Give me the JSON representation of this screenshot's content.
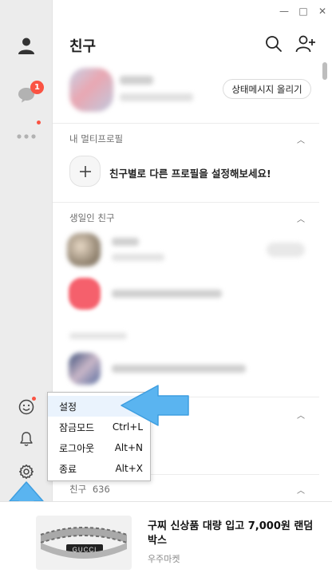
{
  "window": {
    "minimize": "—",
    "maximize": "□",
    "close": "✕"
  },
  "sidebar": {
    "chats_badge": "1"
  },
  "header": {
    "title": "친구"
  },
  "my_profile": {
    "status_button": "상태메시지 올리기"
  },
  "sections": {
    "multi_profile": {
      "label": "내 멀티프로필",
      "action": "친구별로 다른 프로필을 설정해보세요!"
    },
    "birthday": {
      "label": "생일인 친구"
    },
    "friends": {
      "label": "친구",
      "count": "636"
    }
  },
  "context_menu": {
    "items": [
      {
        "label": "설정",
        "shortcut": ""
      },
      {
        "label": "잠금모드",
        "shortcut": "Ctrl+L"
      },
      {
        "label": "로그아웃",
        "shortcut": "Alt+N"
      },
      {
        "label": "종료",
        "shortcut": "Alt+X"
      }
    ]
  },
  "ad": {
    "title": "구찌 신상품 대량 입고 7,000원 랜덤박스",
    "source": "우주마켓",
    "product_text": "GUCCI"
  },
  "colors": {
    "badge": "#fa5343",
    "arrow": "#5ab4f0",
    "sidebar": "#ececec"
  }
}
